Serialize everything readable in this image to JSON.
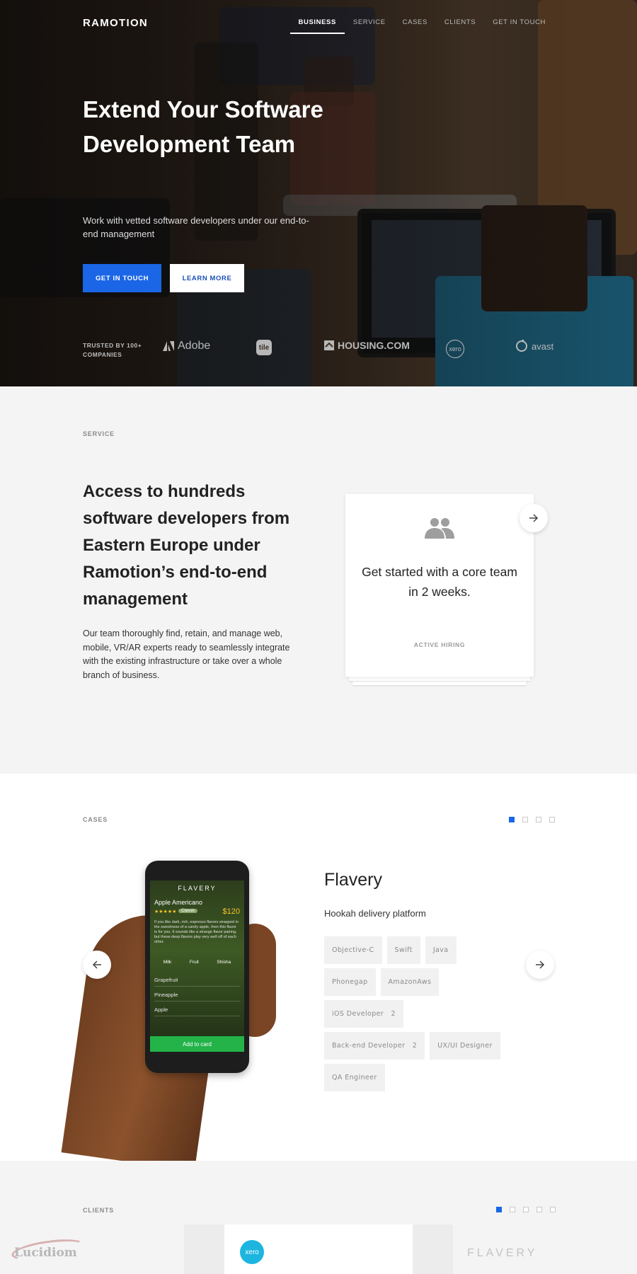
{
  "header": {
    "logo": "RAMOTION",
    "nav": [
      "BUSINESS",
      "SERVICE",
      "CASES",
      "CLIENTS",
      "GET IN TOUCH"
    ],
    "active_nav": "BUSINESS"
  },
  "hero": {
    "title": "Extend Your Software Development Team",
    "subtitle": "Work with vetted software developers under our end-to-end management",
    "primary_button": "GET IN TOUCH",
    "secondary_button": "LEARN MORE",
    "trusted_label": "TRUSTED BY 100+ COMPANIES",
    "company_logos": [
      "Adobe",
      "tile",
      "HOUSING.COM",
      "xero",
      "avast"
    ]
  },
  "service": {
    "label": "SERVICE",
    "heading": "Access to hundreds software developers from Eastern Europe under Ramotion’s end-to-end management",
    "body": "Our team thoroughly find, retain, and manage web, mobile, VR/AR experts ready to seamlessly integrate with the existing infrastructure or take over a whole branch of business.",
    "card": {
      "icon": "group-icon",
      "text": "Get started with a core team in 2 weeks.",
      "status": "ACTIVE HIRING"
    }
  },
  "cases": {
    "label": "CASES",
    "pager_count": 4,
    "pager_active": 1,
    "title": "Flavery",
    "subtitle": "Hookah delivery platform",
    "tags": [
      "Objective-C",
      "Swift",
      "Java",
      "Phonegap",
      "AmazonAws",
      "iOS Developer   2",
      "Back-end Developer   2",
      "UX/UI Designer",
      "QA Engineer"
    ],
    "phone": {
      "app_name": "FLAVERY",
      "product": "Apple Americano",
      "price": "$120",
      "badge": "Classic",
      "description": "If you like dark, rich, espresso flavors wrapped in the sweetness of a candy apple, then this flavor is for you. It sounds like a strange flavor pairing, but these deep flavors play very well off of each other.",
      "options": [
        "Milk",
        "Fruit",
        "Shisha"
      ],
      "list": [
        "Grapefruit",
        "Pineapple",
        "Apple"
      ],
      "cta": "Add to card"
    }
  },
  "clients": {
    "label": "CLIENTS",
    "pager_count": 5,
    "pager_active": 1,
    "logos": [
      "xero",
      "FLAVERY"
    ]
  },
  "watermark": "Lucidiom",
  "colors": {
    "accent": "#1b66e6",
    "cta_green": "#23b349",
    "xero": "#1cb5e0"
  }
}
